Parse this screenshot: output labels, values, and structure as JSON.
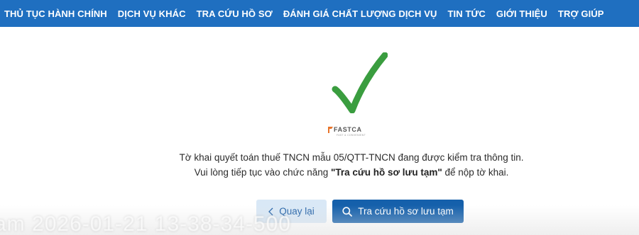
{
  "nav": {
    "items": [
      "THỦ TỤC HÀNH CHÍNH",
      "DỊCH VỤ KHÁC",
      "TRA CỨU HỒ SƠ",
      "ĐÁNH GIÁ CHẤT LƯỢNG DỊCH VỤ",
      "TIN TỨC",
      "GIỚI THIỆU",
      "TRỢ GIÚP"
    ],
    "background": "#1f6fc0"
  },
  "success_icon": "checkmark-icon",
  "success_color": "#3a9d3f",
  "logo": {
    "name": "FASTCA",
    "tagline": "FAST & CONVENIENT"
  },
  "message": {
    "line1": "Tờ khai quyết toán thuế TNCN mẫu 05/QTT-TNCN đang được kiểm tra thông tin.",
    "line2_prefix": "Vui lòng tiếp tục vào chức năng ",
    "line2_bold": "\"Tra cứu hồ sơ lưu tạm\"",
    "line2_suffix": " để nộp tờ khai."
  },
  "buttons": {
    "back_label": "Quay lại",
    "back_icon": "chevron-left-icon",
    "search_label": "Tra cứu hồ sơ lưu tạm",
    "search_icon": "search-icon"
  },
  "watermark": {
    "timestamp": "am 2026-01-21 13-38-34-500"
  }
}
